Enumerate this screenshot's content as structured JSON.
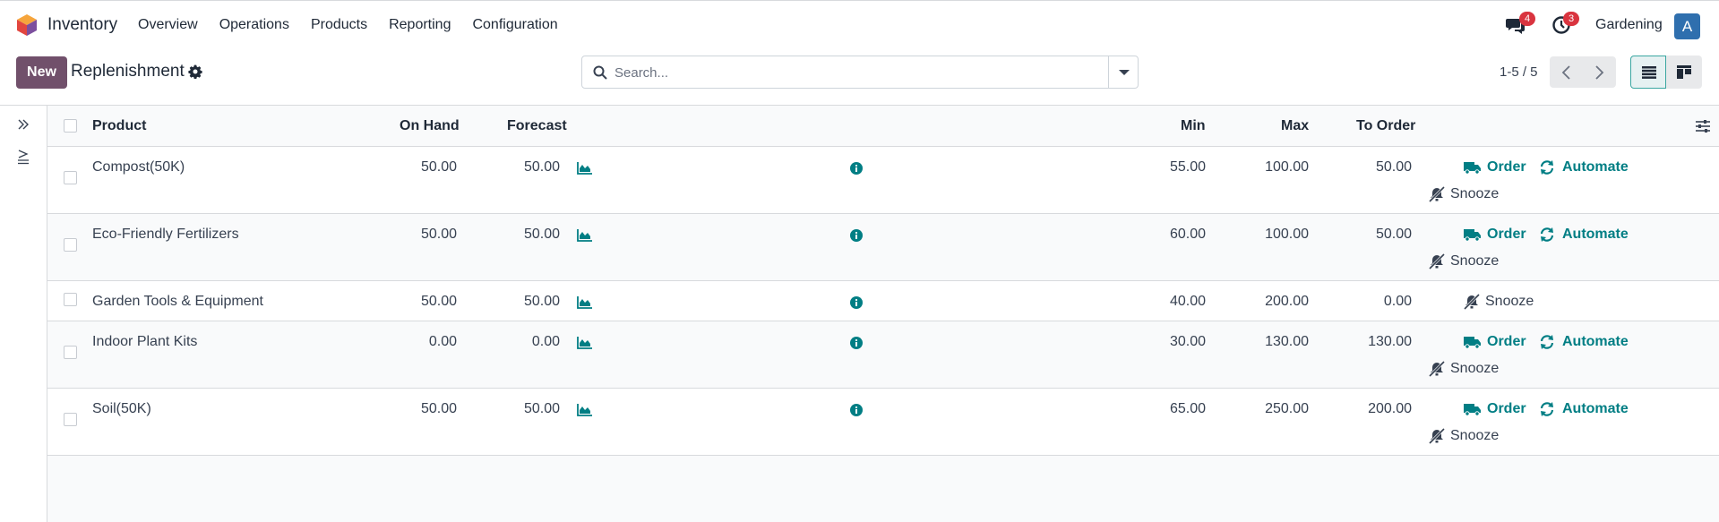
{
  "app": {
    "name": "Inventory"
  },
  "nav": {
    "items": [
      "Overview",
      "Operations",
      "Products",
      "Reporting",
      "Configuration"
    ]
  },
  "systray": {
    "messages_count": "4",
    "activities_count": "3",
    "company": "Gardening",
    "avatar_letter": "A"
  },
  "control": {
    "new_label": "New",
    "title": "Replenishment",
    "search_placeholder": "Search...",
    "pager": "1-5 / 5"
  },
  "table": {
    "headers": {
      "product": "Product",
      "on_hand": "On Hand",
      "forecast": "Forecast",
      "min": "Min",
      "max": "Max",
      "to_order": "To Order"
    },
    "actions": {
      "order": "Order",
      "automate": "Automate",
      "snooze": "Snooze"
    },
    "rows": [
      {
        "product": "Compost(50K)",
        "on_hand": "50.00",
        "forecast": "50.00",
        "min": "55.00",
        "max": "100.00",
        "to_order": "50.00"
      },
      {
        "product": "Eco-Friendly Fertilizers",
        "on_hand": "50.00",
        "forecast": "50.00",
        "min": "60.00",
        "max": "100.00",
        "to_order": "50.00"
      },
      {
        "product": "Garden Tools & Equipment",
        "on_hand": "50.00",
        "forecast": "50.00",
        "min": "40.00",
        "max": "200.00",
        "to_order": "0.00"
      },
      {
        "product": "Indoor Plant Kits",
        "on_hand": "0.00",
        "forecast": "0.00",
        "min": "30.00",
        "max": "130.00",
        "to_order": "130.00"
      },
      {
        "product": "Soil(50K)",
        "on_hand": "50.00",
        "forecast": "50.00",
        "min": "65.00",
        "max": "250.00",
        "to_order": "200.00"
      }
    ]
  },
  "colors": {
    "brand": "#71506b",
    "accent": "#017e84",
    "badge": "#d9343f",
    "avatar": "#2f6fae"
  }
}
